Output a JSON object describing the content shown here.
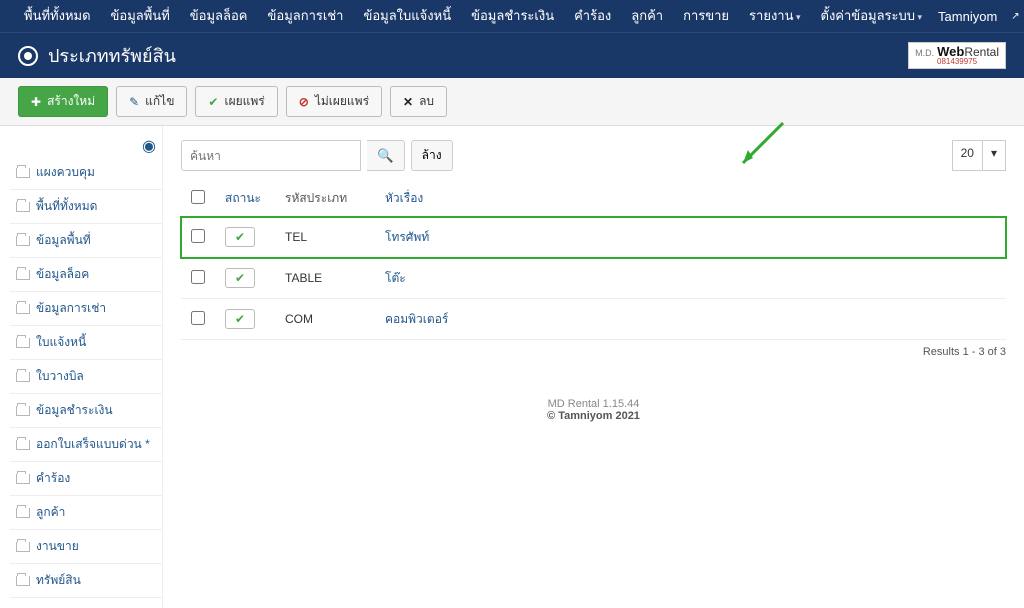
{
  "topnav": {
    "items": [
      {
        "label": "พื้นที่ทั้งหมด"
      },
      {
        "label": "ข้อมูลพื้นที่"
      },
      {
        "label": "ข้อมูลล็อค"
      },
      {
        "label": "ข้อมูลการเช่า"
      },
      {
        "label": "ข้อมูลใบแจ้งหนี้"
      },
      {
        "label": "ข้อมูลชำระเงิน"
      },
      {
        "label": "คำร้อง"
      },
      {
        "label": "ลูกค้า"
      },
      {
        "label": "การขาย"
      },
      {
        "label": "รายงาน",
        "caret": true
      },
      {
        "label": "ตั้งค่าข้อมูลระบบ",
        "caret": true
      }
    ],
    "user": "Tamniyom"
  },
  "page_title": "ประเภททรัพย์สิน",
  "brand": {
    "md": "M.D.",
    "web": "Web",
    "rental": "Rental",
    "sub": "081439975"
  },
  "toolbar": {
    "new": "สร้างใหม่",
    "edit": "แก้ไข",
    "publish": "เผยแพร่",
    "unpublish": "ไม่เผยแพร่",
    "delete": "ลบ"
  },
  "sidebar": [
    {
      "label": "แผงควบคุม"
    },
    {
      "label": "พื้นที่ทั้งหมด"
    },
    {
      "label": "ข้อมูลพื้นที่"
    },
    {
      "label": "ข้อมูลล็อค"
    },
    {
      "label": "ข้อมูลการเช่า"
    },
    {
      "label": "ใบแจ้งหนี้"
    },
    {
      "label": "ใบวางบิล"
    },
    {
      "label": "ข้อมูลชำระเงิน"
    },
    {
      "label": "ออกใบเสร็จแบบด่วน *"
    },
    {
      "label": "คำร้อง"
    },
    {
      "label": "ลูกค้า"
    },
    {
      "label": "งานขาย"
    },
    {
      "label": "ทรัพย์สิน"
    }
  ],
  "search": {
    "placeholder": "ค้นหา",
    "clear": "ล้าง"
  },
  "page_limit": "20",
  "columns": {
    "status": "สถานะ",
    "code": "รหัสประเภท",
    "title": "หัวเรื่อง"
  },
  "rows": [
    {
      "code": "TEL",
      "title": "โทรศัพท์",
      "highlight": true
    },
    {
      "code": "TABLE",
      "title": "โต๊ะ",
      "highlight": false
    },
    {
      "code": "COM",
      "title": "คอมพิวเตอร์",
      "highlight": false
    }
  ],
  "results_text": "Results 1 - 3 of 3",
  "footer": {
    "version": "MD Rental 1.15.44",
    "copyright": "© Tamniyom 2021"
  }
}
